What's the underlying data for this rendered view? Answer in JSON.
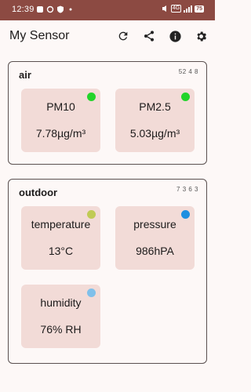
{
  "status_bar": {
    "time": "12:39",
    "network_badge": "4G",
    "battery": "75"
  },
  "app_bar": {
    "title": "My Sensor",
    "actions": [
      {
        "icon": "refresh-icon"
      },
      {
        "icon": "share-icon"
      },
      {
        "icon": "info-icon"
      },
      {
        "icon": "settings-icon"
      }
    ]
  },
  "groups": [
    {
      "name": "air",
      "stamp": "52 4 8",
      "cards": [
        {
          "label": "PM10",
          "value": "7.78µg/m³",
          "indicator_color": "#22d42a"
        },
        {
          "label": "PM2.5",
          "value": "5.03µg/m³",
          "indicator_color": "#22d42a"
        }
      ]
    },
    {
      "name": "outdoor",
      "stamp": "7 3 6 3",
      "cards": [
        {
          "label": "temperature",
          "value": "13°C",
          "indicator_color": "#c0cb55"
        },
        {
          "label": "pressure",
          "value": "986hPA",
          "indicator_color": "#1f8fe0"
        },
        {
          "label": "humidity",
          "value": "76% RH",
          "indicator_color": "#7fc0ea"
        }
      ]
    }
  ]
}
